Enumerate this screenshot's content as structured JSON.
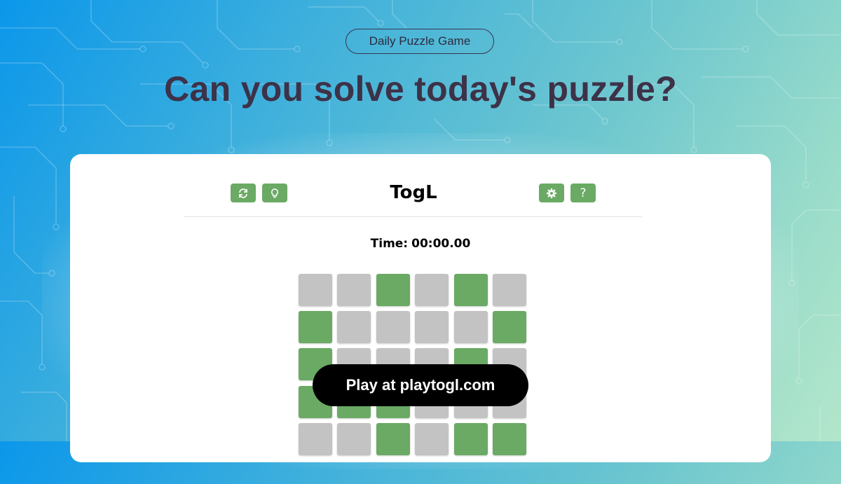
{
  "banner": {
    "tag_label": "Daily Puzzle Game",
    "headline": "Can you solve today's puzzle?"
  },
  "game": {
    "title": "TogL",
    "timer_label": "Time:",
    "timer_value": "00:00.00",
    "toolbar": {
      "left_icons": [
        "refresh-icon",
        "lightbulb-icon"
      ],
      "right_icons": [
        "gear-icon",
        "question-icon"
      ],
      "help_glyph": "?"
    },
    "board": {
      "columns": 6,
      "visible_rows": [
        [
          0,
          0,
          1,
          0,
          1,
          0
        ],
        [
          1,
          0,
          0,
          0,
          0,
          1
        ],
        [
          1,
          0,
          0,
          0,
          1,
          0
        ],
        [
          1,
          1,
          1,
          0,
          0,
          0
        ],
        [
          0,
          0,
          1,
          0,
          1,
          1
        ]
      ]
    }
  },
  "cta": {
    "label": "Play at playtogl.com"
  },
  "colors": {
    "accent_green": "#6aaa64",
    "tile_gray": "#c3c3c3",
    "headline": "#3d3248",
    "cta_background": "#000000"
  }
}
